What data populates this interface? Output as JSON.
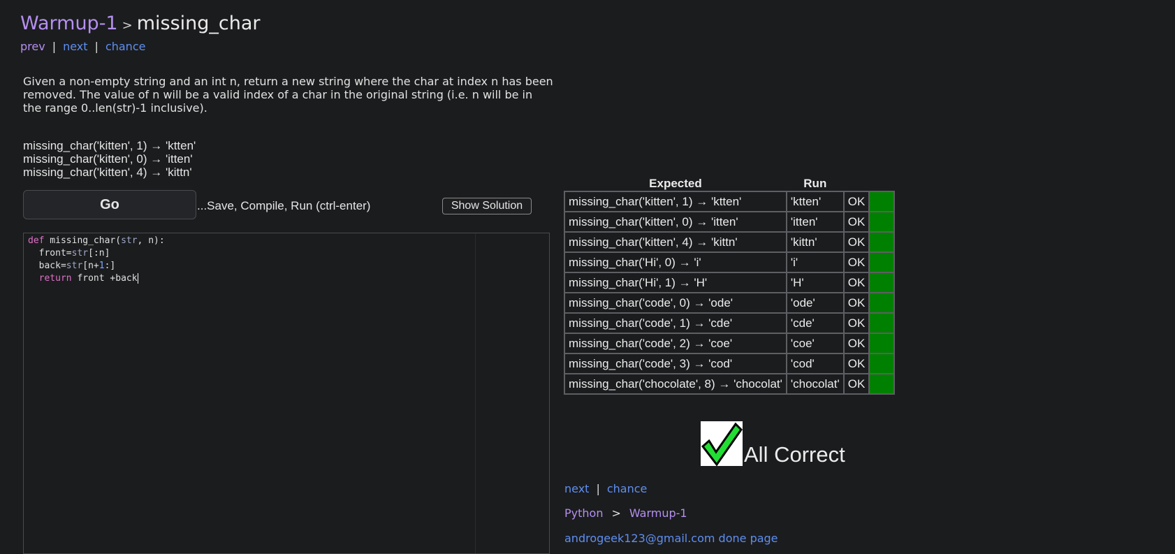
{
  "header": {
    "section": "Warmup-1",
    "separator": ">",
    "problem": "missing_char"
  },
  "nav_top": {
    "prev": "prev",
    "next": "next",
    "chance": "chance",
    "divider": "|"
  },
  "description": "Given a non-empty string and an int n, return a new string where the char at index n has been removed. The value of n will be a valid index of a char in the original string (i.e. n will be in the range 0..len(str)-1 inclusive).",
  "examples": [
    "missing_char('kitten', 1) → 'ktten'",
    "missing_char('kitten', 0) → 'itten'",
    "missing_char('kitten', 4) → 'kittn'"
  ],
  "controls": {
    "go_label": "Go",
    "go_hint": "...Save, Compile, Run (ctrl-enter)",
    "show_solution_label": "Show Solution"
  },
  "editor": {
    "lines": [
      "def missing_char(str, n):",
      "  front=str[:n]",
      "  back=str[n+1:]",
      "  return front +back"
    ]
  },
  "results": {
    "headers": {
      "expected": "Expected",
      "run": "Run"
    },
    "ok_color": "#008000",
    "rows": [
      {
        "expected": "missing_char('kitten', 1) → 'ktten'",
        "run": "'ktten'",
        "status": "OK"
      },
      {
        "expected": "missing_char('kitten', 0) → 'itten'",
        "run": "'itten'",
        "status": "OK"
      },
      {
        "expected": "missing_char('kitten', 4) → 'kittn'",
        "run": "'kittn'",
        "status": "OK"
      },
      {
        "expected": "missing_char('Hi', 0) → 'i'",
        "run": "'i'",
        "status": "OK"
      },
      {
        "expected": "missing_char('Hi', 1) → 'H'",
        "run": "'H'",
        "status": "OK"
      },
      {
        "expected": "missing_char('code', 0) → 'ode'",
        "run": "'ode'",
        "status": "OK"
      },
      {
        "expected": "missing_char('code', 1) → 'cde'",
        "run": "'cde'",
        "status": "OK"
      },
      {
        "expected": "missing_char('code', 2) → 'coe'",
        "run": "'coe'",
        "status": "OK"
      },
      {
        "expected": "missing_char('code', 3) → 'cod'",
        "run": "'cod'",
        "status": "OK"
      },
      {
        "expected": "missing_char('chocolate', 8) → 'chocolat'",
        "run": "'chocolat'",
        "status": "OK"
      }
    ]
  },
  "all_correct": "All Correct",
  "nav_bottom": {
    "next": "next",
    "chance": "chance",
    "divider": "|"
  },
  "breadcrumb": {
    "language": "Python",
    "separator": ">",
    "section": "Warmup-1"
  },
  "done_line": "androgeek123@gmail.com done page",
  "colors": {
    "background": "#1b1c1e",
    "link_purple": "#b48ff0",
    "link_blue": "#5f8ff0",
    "pass_green": "#008000"
  }
}
